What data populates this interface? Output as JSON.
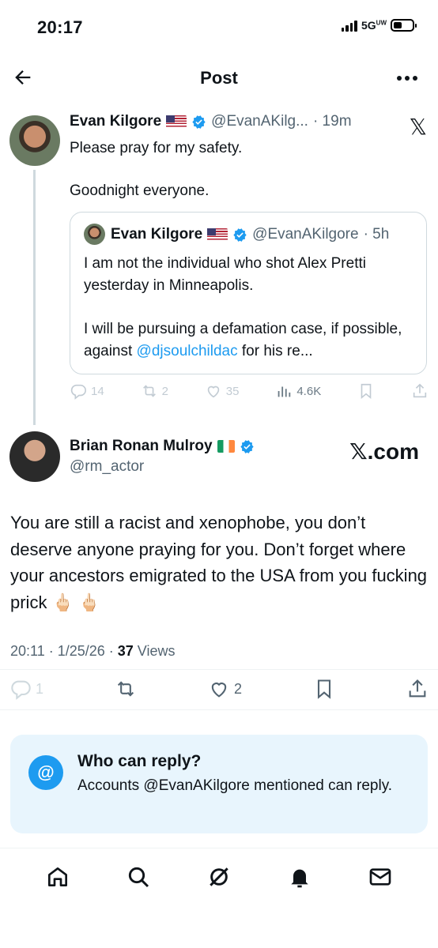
{
  "status_bar": {
    "time": "20:17",
    "network": "5G",
    "network_sup": "UW"
  },
  "header": {
    "title": "Post"
  },
  "thread_tweet": {
    "name": "Evan Kilgore",
    "handle": "@EvanAKilg...",
    "time": "· 19m",
    "line1": "Please pray for my safety.",
    "line2": "Goodnight everyone."
  },
  "x_logo": "𝕏",
  "quote": {
    "name": "Evan Kilgore",
    "handle": "@EvanAKilgore",
    "time": "· 5h",
    "para1": "I am not the individual who shot Alex Pretti yesterday in Minneapolis.",
    "para2_start": "I will be pursuing a defamation case, if possible, against ",
    "mention": "@djsoulchildac",
    "para2_end": " for his re..."
  },
  "thread_actions": {
    "replies": "14",
    "reposts": "2",
    "likes": "35",
    "views": "4.6K"
  },
  "main_tweet": {
    "name": "Brian Ronan Mulroy",
    "handle": "@rm_actor",
    "watermark": "𝕏.com",
    "text": "You are still a racist and xenophobe, you don’t deserve anyone praying for you. Don’t forget where your ancestors emigrated to the USA from you fucking prick 🖕🏻 🖕🏻",
    "meta_time": "20:11 · 1/25/26 · ",
    "views_count": "37",
    "views_label": " Views"
  },
  "main_actions": {
    "replies": "1",
    "likes": "2"
  },
  "reply_restriction": {
    "icon": "@",
    "title": "Who can reply?",
    "body": "Accounts @EvanAKilgore mentioned can reply."
  },
  "icons": [
    "back-arrow-icon",
    "more-icon",
    "verified-icon",
    "reply-icon",
    "repost-icon",
    "like-icon",
    "views-icon",
    "bookmark-icon",
    "share-icon",
    "home-icon",
    "search-icon",
    "grok-icon",
    "notifications-icon",
    "messages-icon"
  ],
  "colors": {
    "accent": "#1d9bf0",
    "text": "#0f1419",
    "secondary": "#536471",
    "reply_box": "#e8f5fd"
  }
}
